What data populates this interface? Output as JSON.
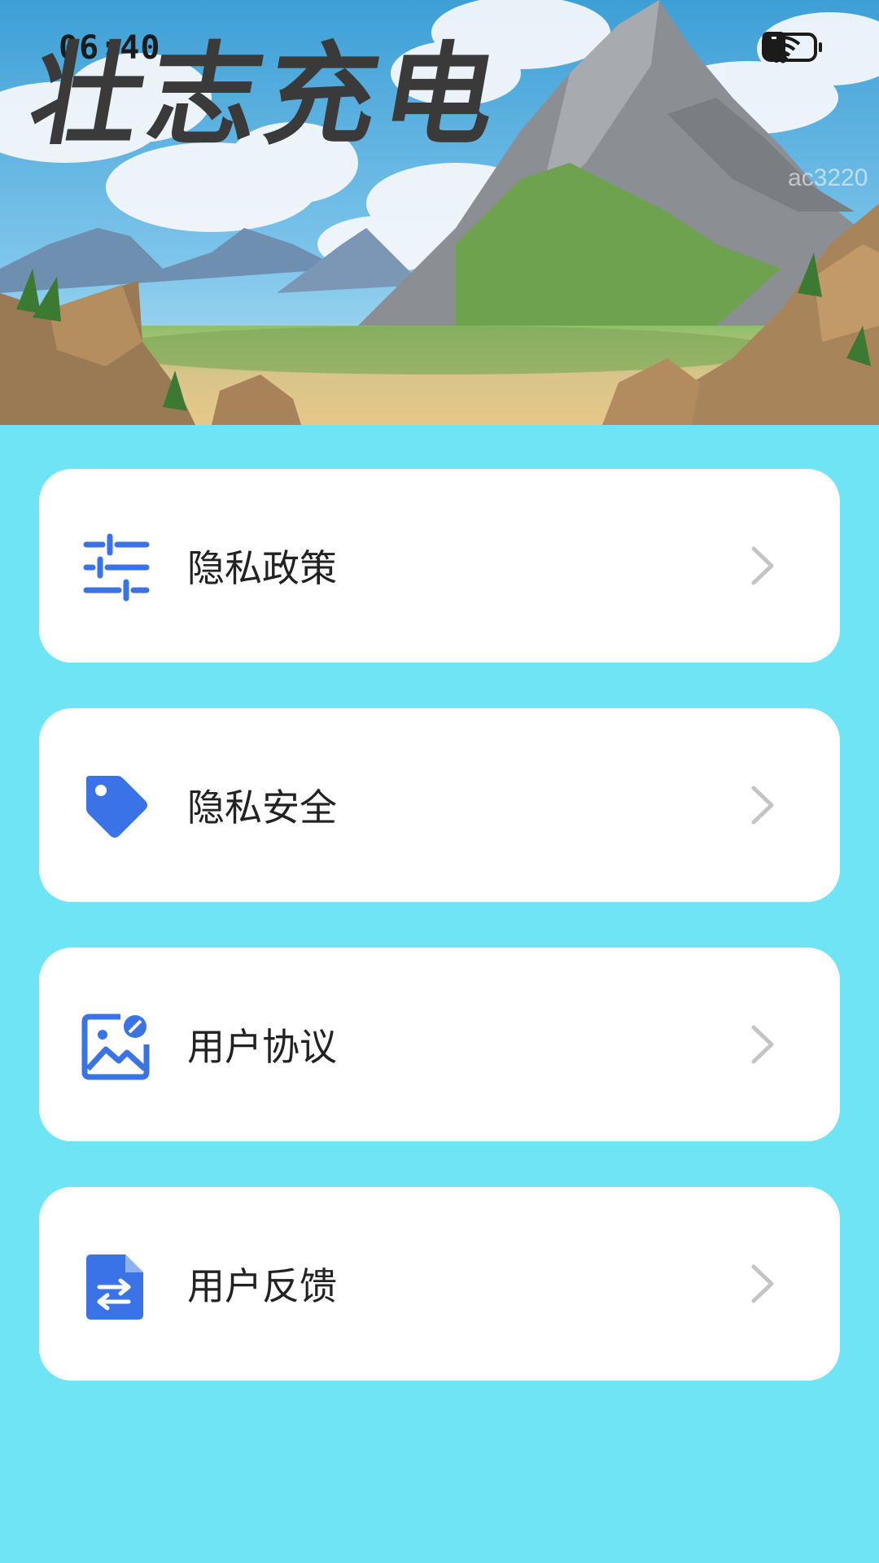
{
  "status_bar": {
    "time": "06:40",
    "icons": [
      "bluetooth-icon",
      "mute-bell-icon",
      "wifi-icon",
      "alert-icon",
      "battery-icon"
    ],
    "battery_level": 0.25
  },
  "header": {
    "title": "壮志充电",
    "watermark": "ac3220",
    "background": "mountain-landscape-illustration"
  },
  "menu": {
    "items": [
      {
        "label": "隐私政策",
        "icon": "sliders-icon"
      },
      {
        "label": "隐私安全",
        "icon": "tag-icon"
      },
      {
        "label": "用户协议",
        "icon": "image-icon"
      },
      {
        "label": "用户反馈",
        "icon": "file-swap-icon"
      }
    ]
  },
  "colors": {
    "background": "#6fe4f5",
    "card": "#ffffff",
    "icon_accent": "#3a73e6",
    "chevron": "#c4c4c4",
    "text": "#222222"
  }
}
